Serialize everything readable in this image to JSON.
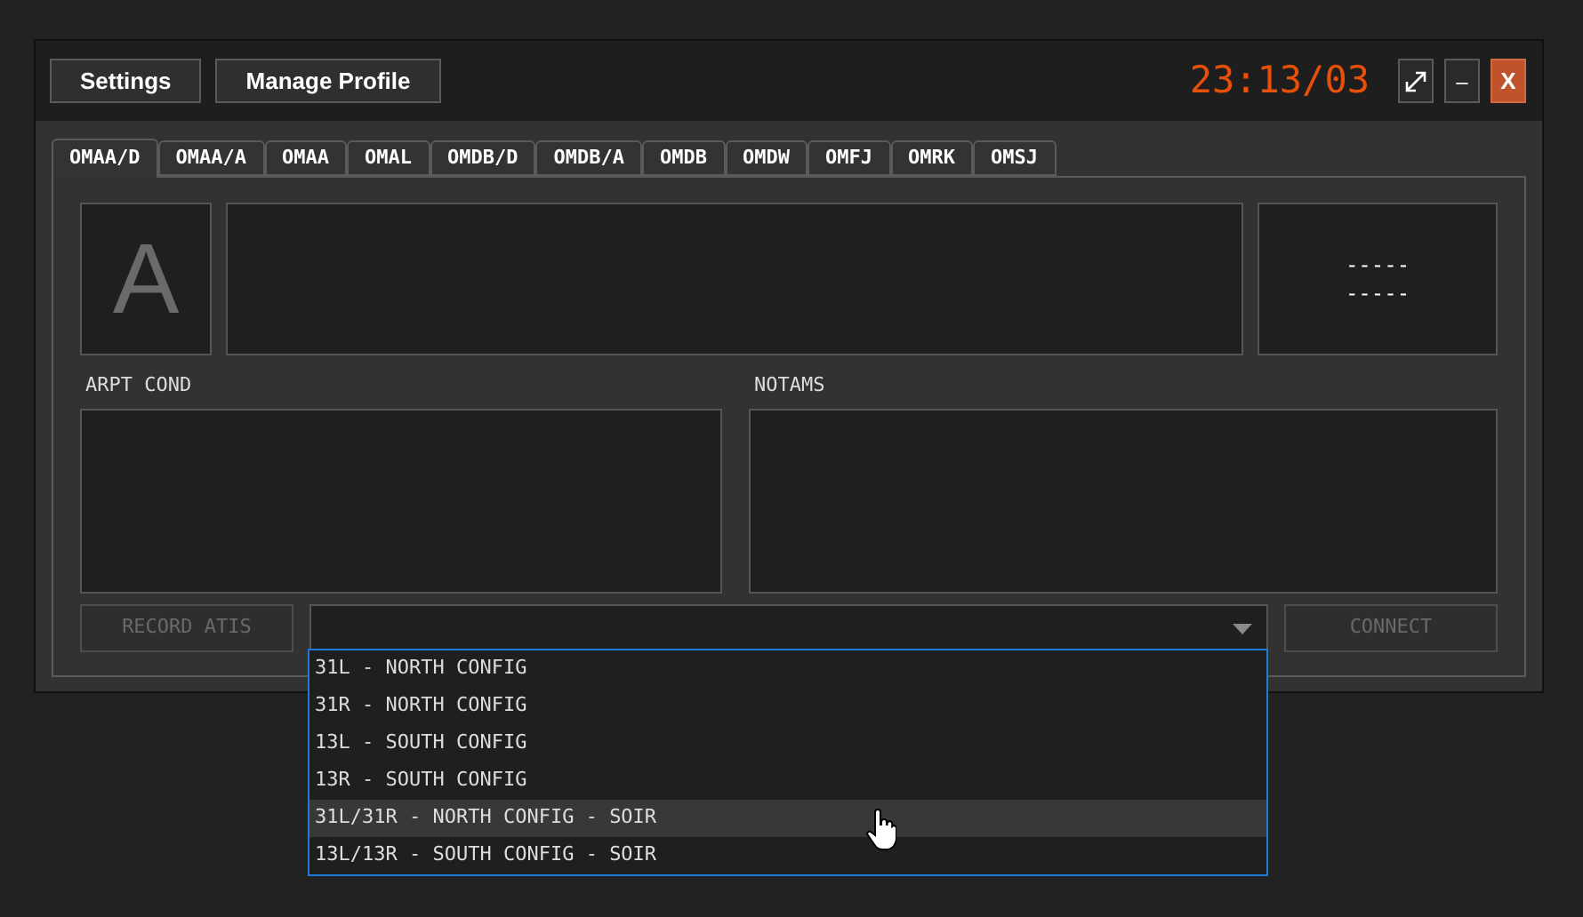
{
  "header": {
    "buttons": [
      "Settings",
      "Manage Profile"
    ],
    "clock": "23:13/03",
    "window_controls": [
      {
        "kind": "maximize"
      },
      {
        "kind": "minimize",
        "label": "–"
      },
      {
        "kind": "close",
        "label": "X"
      }
    ]
  },
  "tabs": [
    {
      "label": "OMAA/D",
      "selected": true
    },
    {
      "label": "OMAA/A",
      "selected": false
    },
    {
      "label": "OMAA",
      "selected": false
    },
    {
      "label": "OMAL",
      "selected": false
    },
    {
      "label": "OMDB/D",
      "selected": false
    },
    {
      "label": "OMDB/A",
      "selected": false
    },
    {
      "label": "OMDB",
      "selected": false
    },
    {
      "label": "OMDW",
      "selected": false
    },
    {
      "label": "OMFJ",
      "selected": false
    },
    {
      "label": "OMRK",
      "selected": false
    },
    {
      "label": "OMSJ",
      "selected": false
    }
  ],
  "atis_letter": "A",
  "info_lines": [
    "-----",
    "-----"
  ],
  "sections": [
    {
      "label": "ARPT COND"
    },
    {
      "label": "NOTAMS"
    }
  ],
  "record_button": {
    "label": "RECORD ATIS",
    "disabled": true
  },
  "config_dropdown": {
    "expanded": true,
    "options": [
      {
        "label": "31L - NORTH CONFIG",
        "highlighted": false
      },
      {
        "label": "31R - NORTH CONFIG",
        "highlighted": false
      },
      {
        "label": "13L - SOUTH CONFIG",
        "highlighted": false
      },
      {
        "label": "13R - SOUTH CONFIG",
        "highlighted": false
      },
      {
        "label": "31L/31R - NORTH CONFIG - SOIR",
        "highlighted": true
      },
      {
        "label": "13L/13R - SOUTH CONFIG - SOIR",
        "highlighted": false
      }
    ]
  },
  "connect_button": {
    "label": "CONNECT",
    "disabled": true
  }
}
